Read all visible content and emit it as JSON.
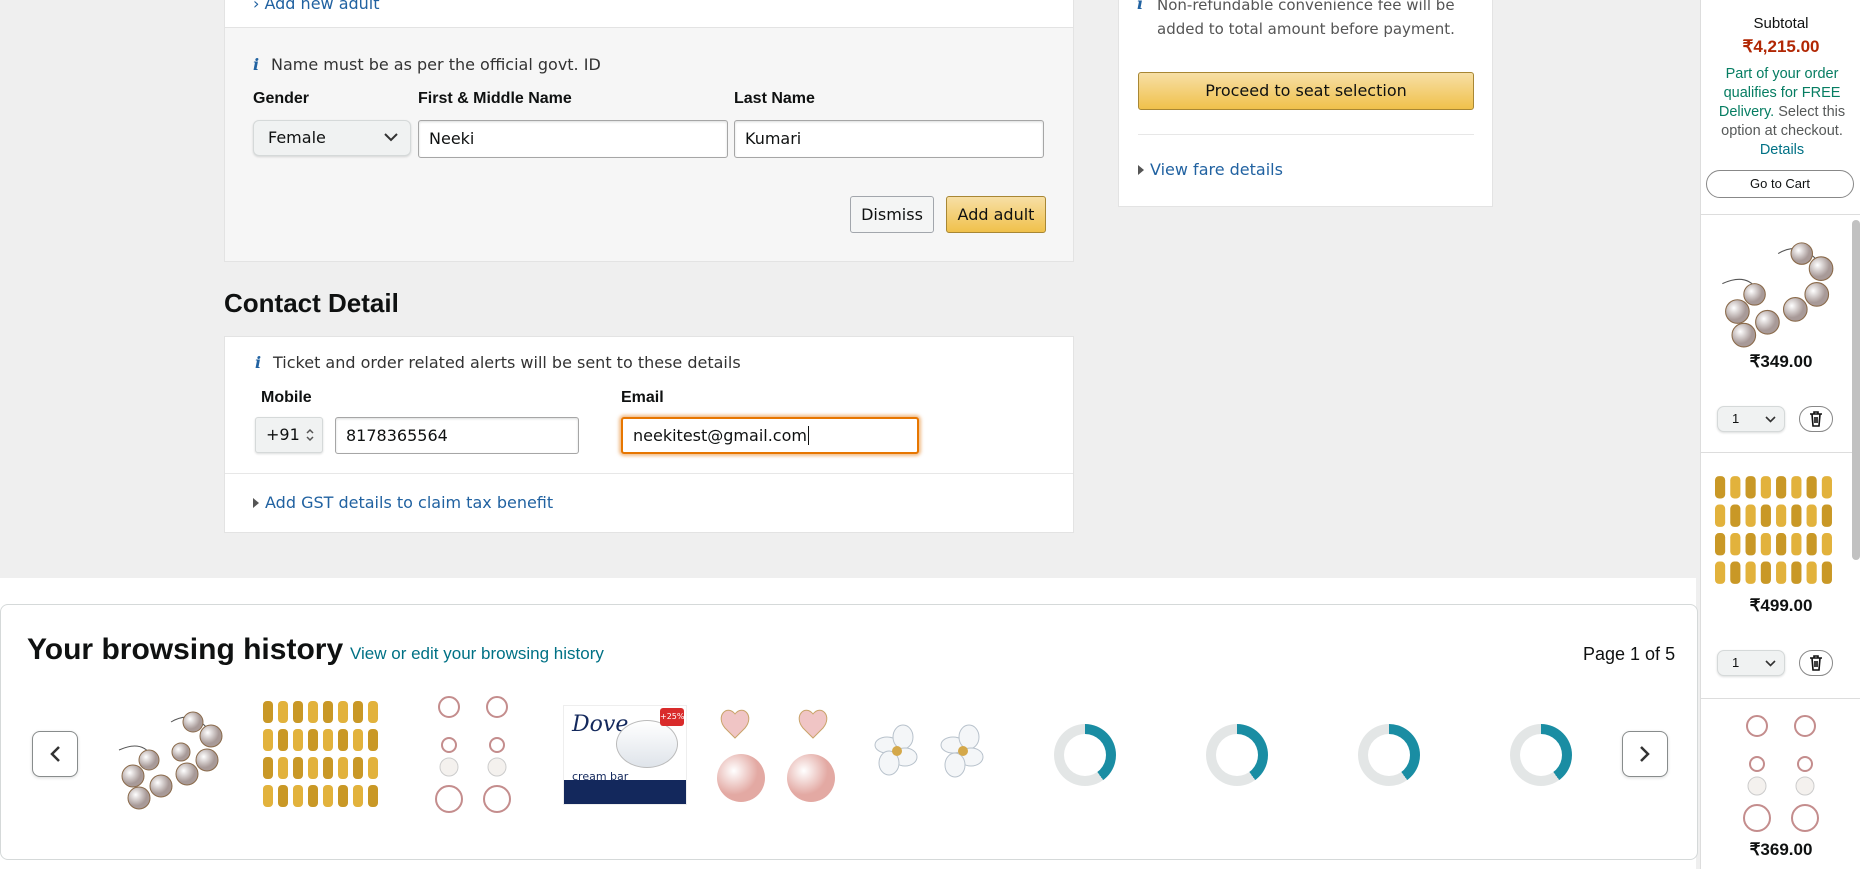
{
  "passenger": {
    "add_adult_link": "Add new adult",
    "id_note": "Name must be as per the official govt. ID",
    "gender_label": "Gender",
    "gender_value": "Female",
    "first_name_label": "First & Middle Name",
    "first_name_value": "Neeki",
    "last_name_label": "Last Name",
    "last_name_value": "Kumari",
    "dismiss_label": "Dismiss",
    "add_adult_label": "Add adult"
  },
  "contact": {
    "heading": "Contact Detail",
    "alert_note": "Ticket and order related alerts will be sent to these details",
    "mobile_label": "Mobile",
    "country_code": "+91",
    "mobile_value": "8178365564",
    "email_label": "Email",
    "email_value": "neekitest@gmail.com",
    "gst_link": "Add GST details to claim tax benefit"
  },
  "summary": {
    "fee_note": "Non-refundable convenience fee will be added to total amount before payment.",
    "proceed_label": "Proceed to seat selection",
    "fare_link": "View fare details"
  },
  "history": {
    "title": "Your browsing history",
    "edit_link": "View or edit your browsing history",
    "page_indicator": "Page 1 of 5",
    "items": [
      "pearl hoop earrings",
      "gold earring set",
      "pearl flower drop earrings",
      "Dove cream bar",
      "pink heart pearl drop earrings",
      "white flower earrings",
      "loading",
      "loading",
      "loading",
      "loading"
    ],
    "dove_brand": "Dove",
    "dove_sub": "cream bar",
    "dove_badge": "+25%"
  },
  "cart": {
    "subtotal_label": "Subtotal",
    "subtotal_value": "₹4,215.00",
    "free_delivery": "Part of your order qualifies for FREE Delivery.",
    "select_option": "Select this option at checkout.",
    "details_link": "Details",
    "go_to_cart": "Go to Cart",
    "items": [
      {
        "price": "₹349.00",
        "qty": "1"
      },
      {
        "price": "₹499.00",
        "qty": "1"
      },
      {
        "price": "₹369.00"
      }
    ]
  },
  "colors": {
    "link": "#2162a1",
    "price_red": "#b12704",
    "free_green": "#067d62",
    "button_yellow": "#f0c14b",
    "focus_orange": "#e77600"
  }
}
